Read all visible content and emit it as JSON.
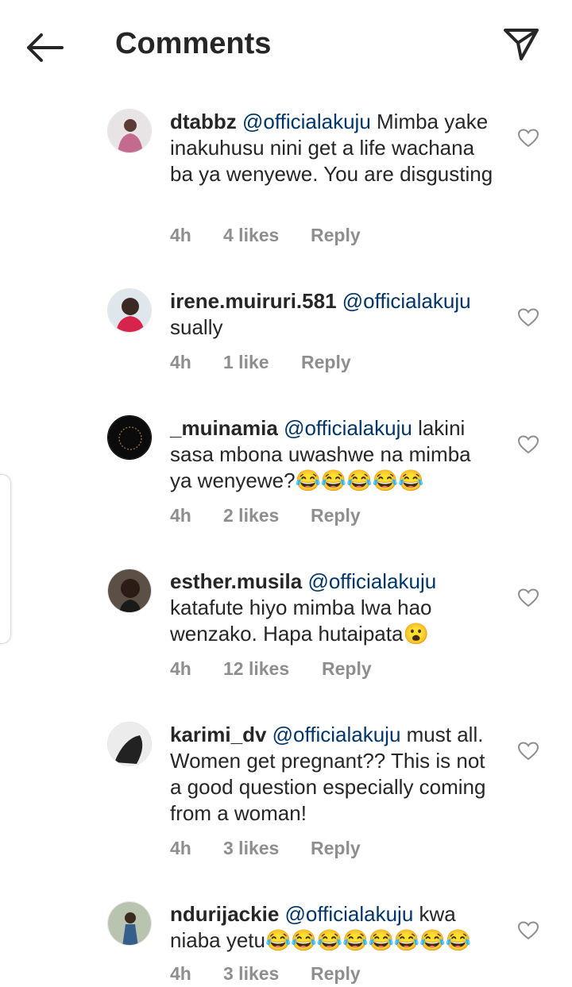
{
  "header": {
    "title": "Comments"
  },
  "icons": {
    "back": "back-arrow-icon",
    "send": "send-icon",
    "like": "heart-icon"
  },
  "colors": {
    "mention": "#003569",
    "meta": "#8e8e8e",
    "text": "#262626"
  },
  "comments": [
    {
      "username": "dtabbz",
      "mention": "@officialakuju",
      "text": " Mimba yake inakuhusu nini get a life wachana ba ya wenyewe. You are disgusting",
      "emojis": "",
      "time": "4h",
      "likes": "4 likes",
      "reply": "Reply"
    },
    {
      "username": "irene.muiruri.581",
      "mention": "@officialakuju",
      "text": " sually",
      "emojis": "",
      "time": "4h",
      "likes": "1 like",
      "reply": "Reply"
    },
    {
      "username": "_muinamia",
      "mention": "@officialakuju",
      "text": " lakini sasa mbona uwashwe na mimba ya wenyewe?",
      "emojis": "😂😂😂😂😂",
      "time": "4h",
      "likes": "2 likes",
      "reply": "Reply"
    },
    {
      "username": "esther.musila",
      "mention": "@officialakuju",
      "text": " katafute hiyo mimba lwa hao wenzako.  Hapa hutaipata",
      "emojis": "😮",
      "time": "4h",
      "likes": "12 likes",
      "reply": "Reply"
    },
    {
      "username": "karimi_dv",
      "mention": "@officialakuju",
      "text": " must all. Women get pregnant?? This is not a good question especially coming from a woman!",
      "emojis": "",
      "time": "4h",
      "likes": "3 likes",
      "reply": "Reply"
    },
    {
      "username": "ndurijackie",
      "mention": "@officialakuju",
      "text": " kwa niaba yetu",
      "emojis": "😂😂😂😂😂😂😂😂",
      "time": "4h",
      "likes": "3 likes",
      "reply": "Reply"
    }
  ]
}
